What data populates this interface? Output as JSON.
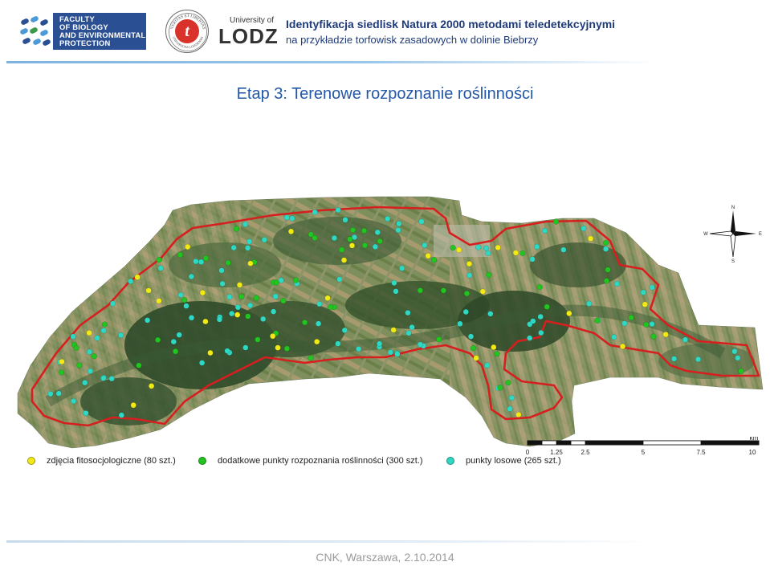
{
  "header": {
    "faculty_lines": [
      "FACULTY",
      "OF BIOLOGY",
      "AND ENVIRONMENTAL",
      "PROTECTION"
    ],
    "seal_motto": "VERITAS ET LIBERTAS",
    "seal_university": "UNIVERSITAS LODZIENSIS",
    "uol_small": "University of",
    "uol_big": "LODZ",
    "title": "Identyfikacja siedlisk Natura 2000  metodami teledetekcyjnymi",
    "subtitle": "na przykładzie torfowisk zasadowych w dolinie Biebrzy"
  },
  "slide_title": "Etap 3: Terenowe rozpoznanie roślinności",
  "compass": {
    "n": "N",
    "s": "S",
    "e": "E",
    "w": "W"
  },
  "scale_bar": {
    "unit": "km",
    "labels": [
      "0",
      "1.25",
      "2.5",
      "5",
      "7.5",
      "10"
    ]
  },
  "legend": [
    {
      "label": "zdjęcia fitosocjologiczne (80 szt.)",
      "color": "#f2ea15",
      "count": 80
    },
    {
      "label": "dodatkowe punkty rozpoznania roślinności (300 szt.)",
      "color": "#22c41f",
      "count": 300
    },
    {
      "label": "punkty losowe (265 szt.)",
      "color": "#2fd8c2",
      "count": 265
    }
  ],
  "colors": {
    "boundary": "#d61f1f",
    "map_base": "#5c7347",
    "title_blue": "#2357a8",
    "header_blue": "#1f3b7a"
  },
  "footer": "CNK, Warszawa, 2.10.2014"
}
